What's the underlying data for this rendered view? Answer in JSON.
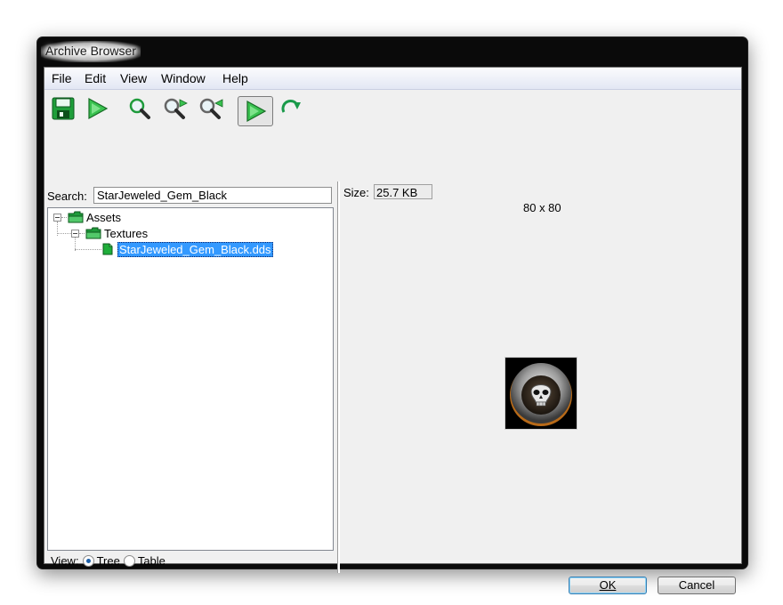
{
  "window": {
    "title": "Archive Browser"
  },
  "menu": [
    "File",
    "Edit",
    "View",
    "Window",
    "Help"
  ],
  "toolbar": [
    {
      "icon": "save-icon"
    },
    {
      "icon": "play-icon"
    },
    {
      "icon": "search-icon"
    },
    {
      "icon": "search-next-icon"
    },
    {
      "icon": "search-previous-icon"
    },
    {
      "icon": "play-toggle-icon",
      "pressed": true
    },
    {
      "icon": "refresh-icon"
    }
  ],
  "search": {
    "label": "Search:",
    "value": "StarJeweled_Gem_Black"
  },
  "tree": {
    "root": "Assets",
    "folder": "Textures",
    "file": "StarJeweled_Gem_Black.dds"
  },
  "view": {
    "label": "View:",
    "options": [
      "Tree",
      "Table"
    ],
    "selected": "Tree"
  },
  "preview": {
    "size_label": "Size:",
    "size_value": "25.7 KB",
    "dimensions": "80 x 80"
  },
  "buttons": {
    "ok": "OK",
    "cancel": "Cancel"
  },
  "colors": {
    "selection": "#3399ff",
    "icon_green": "#1fae3a",
    "refresh_green": "#1a9a4a"
  }
}
